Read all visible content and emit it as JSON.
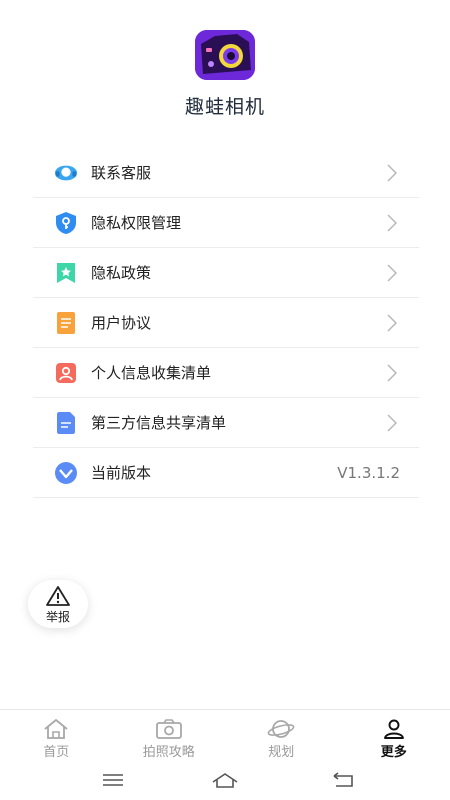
{
  "app": {
    "name": "趣蛙相机"
  },
  "menu": {
    "items": [
      {
        "label": "联系客服",
        "icon": "customer-service-icon",
        "color": "#3aa6f0"
      },
      {
        "label": "隐私权限管理",
        "icon": "key-shield-icon",
        "color": "#2f8cf0"
      },
      {
        "label": "隐私政策",
        "icon": "star-bookmark-icon",
        "color": "#3dd6a8"
      },
      {
        "label": "用户协议",
        "icon": "document-icon",
        "color": "#f7a23b"
      },
      {
        "label": "个人信息收集清单",
        "icon": "user-card-icon",
        "color": "#f46a5c"
      },
      {
        "label": "第三方信息共享清单",
        "icon": "file-icon",
        "color": "#5b8cf6"
      },
      {
        "label": "当前版本",
        "icon": "version-icon",
        "color": "#5b8cf6",
        "value": "V1.3.1.2"
      }
    ]
  },
  "report": {
    "label": "举报",
    "icon": "warning-icon"
  },
  "tabbar": {
    "tabs": [
      {
        "label": "首页",
        "icon": "home-icon"
      },
      {
        "label": "拍照攻略",
        "icon": "camera-icon"
      },
      {
        "label": "规划",
        "icon": "planet-icon"
      },
      {
        "label": "更多",
        "icon": "user-icon",
        "active": true
      }
    ]
  },
  "system_nav": {
    "icons": [
      "menu-lines-icon",
      "home-outline-icon",
      "back-icon"
    ]
  }
}
